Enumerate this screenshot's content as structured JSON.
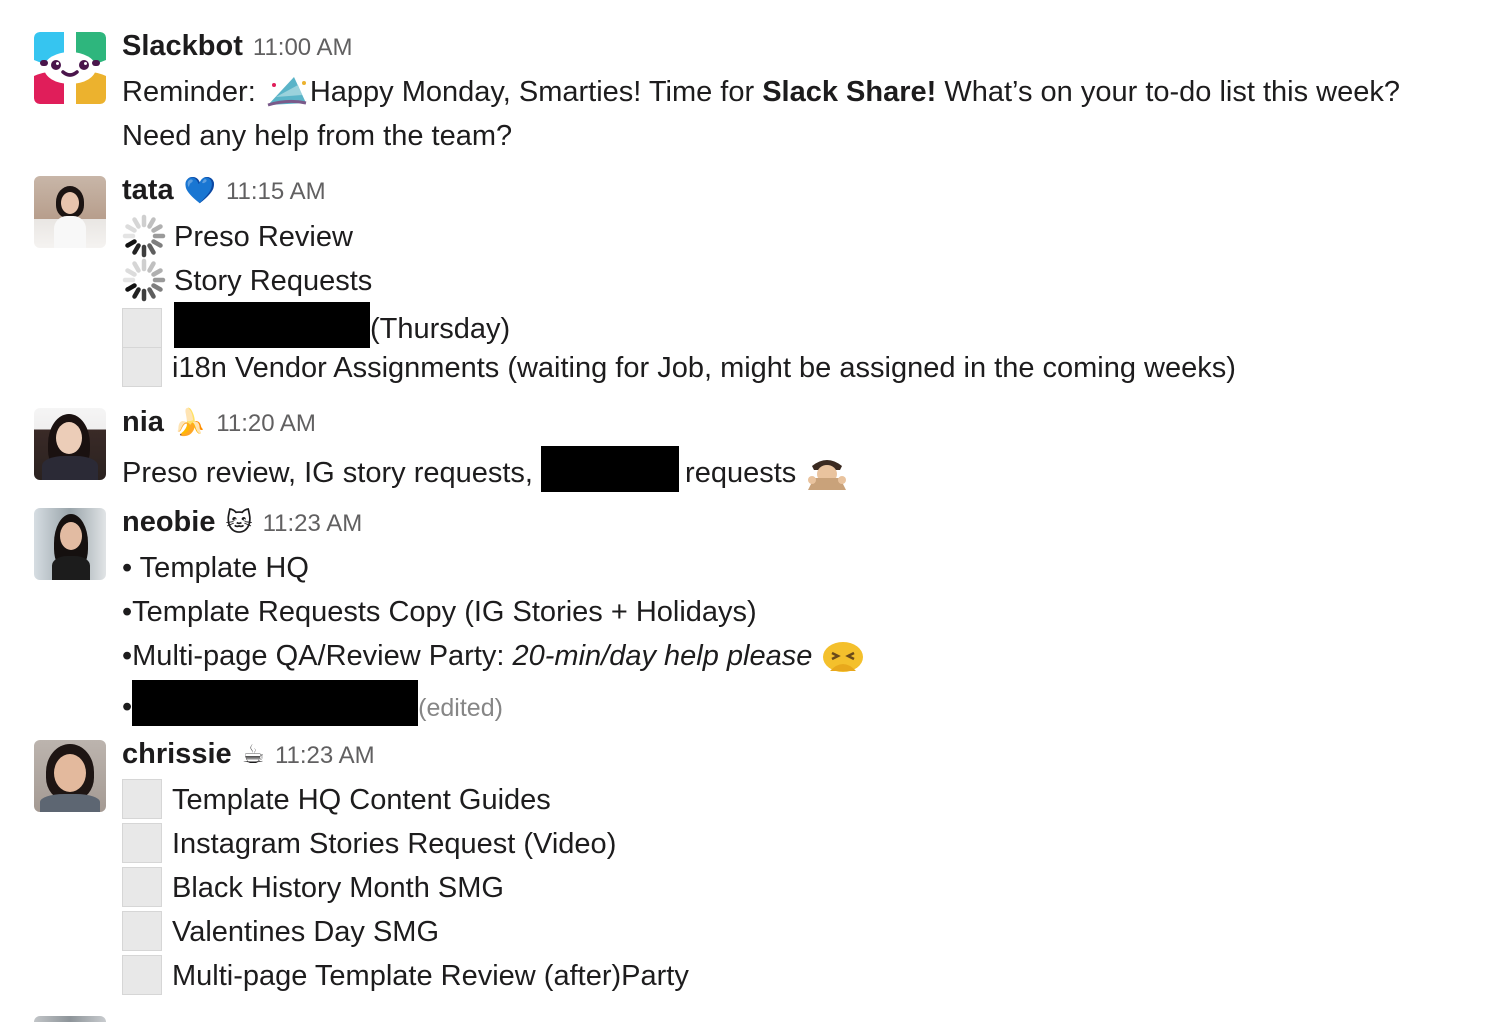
{
  "messages": {
    "slackbot": {
      "name": "Slackbot",
      "time": "11:00 AM",
      "text_prefix": "Reminder:",
      "text_part1": "Happy Monday, Smarties! Time for ",
      "text_bold": "Slack Share!",
      "text_part2": " What’s on your to-do list this week?",
      "text_line2": "Need any help from the team?",
      "emoji_name": "party-hat-icon"
    },
    "tata": {
      "name": "tata",
      "status_emoji": "💙",
      "time": "11:15 AM",
      "items": [
        {
          "icon": "loading-spinner-icon",
          "text": "Preso Review"
        },
        {
          "icon": "loading-spinner-icon",
          "text": "Story Requests"
        },
        {
          "icon": "checkbox-empty-icon",
          "text": "(Thursday)"
        },
        {
          "icon": "checkbox-empty-icon",
          "text": "i18n Vendor Assignments (waiting for Job, might be assigned in the coming weeks)"
        }
      ]
    },
    "nia": {
      "name": "nia",
      "status_emoji": "🍌",
      "time": "11:20 AM",
      "text_part1": "Preso review, IG story requests, ",
      "text_part2": "requests"
    },
    "neobie": {
      "name": "neobie",
      "status_emoji": "🐱",
      "time": "11:23 AM",
      "item1": "• Template HQ",
      "item2": "•Template Requests Copy (IG Stories + Holidays)",
      "item3_plain": "•Multi-page QA/Review Party: ",
      "item3_italic": "20-min/day help please",
      "item4_bullet": "•",
      "edited": "(edited)"
    },
    "chrissie": {
      "name": "chrissie",
      "status_emoji": "☕",
      "time": "11:23 AM",
      "items": [
        "Template HQ Content Guides",
        "Instagram Stories Request (Video)",
        "Black History Month SMG",
        "Valentines Day SMG",
        "Multi-page Template Review (after)Party"
      ]
    }
  }
}
